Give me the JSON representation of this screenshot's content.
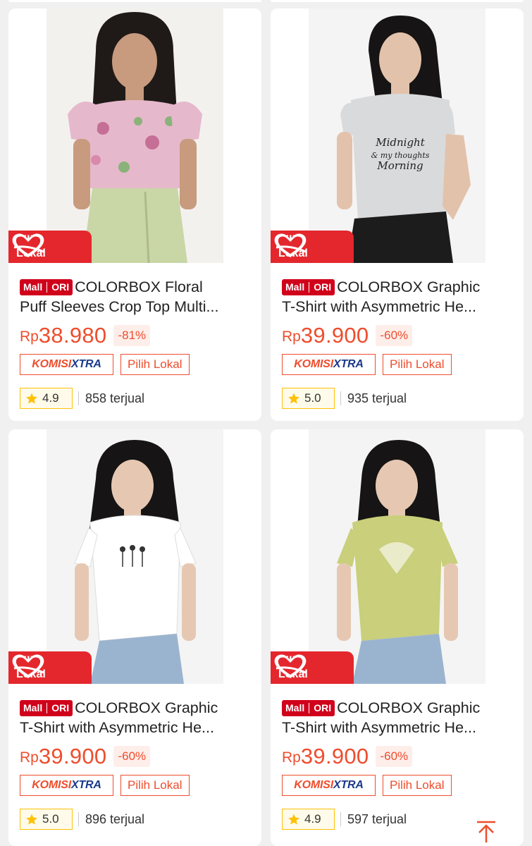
{
  "products": [
    {
      "mall_label": "Mall",
      "ori_label": "ORI",
      "title_line1": "COLORBOX Floral",
      "title_line2": "Puff Sleeves Crop Top Multi...",
      "currency": "Rp",
      "price": "38.980",
      "discount": "-81%",
      "komisi_a": "KOMISI",
      "komisi_b": "XTRA",
      "tag": "Pilih Lokal",
      "rating": "4.9",
      "sold": "858 terjual",
      "badge_line1": "Pilih",
      "badge_line2": "Lokal",
      "palette": {
        "bg": "#f3f1ee",
        "top": "#e6b8cc",
        "bottom": "#c9d6a6",
        "hair": "#1f1a18",
        "skin": "#c89a7e"
      }
    },
    {
      "mall_label": "Mall",
      "ori_label": "ORI",
      "title_line1": "COLORBOX Graphic",
      "title_line2": "T-Shirt with Asymmetric He...",
      "currency": "Rp",
      "price": "39.900",
      "discount": "-60%",
      "komisi_a": "KOMISI",
      "komisi_b": "XTRA",
      "tag": "Pilih Lokal",
      "rating": "5.0",
      "sold": "935 terjual",
      "badge_line1": "Pilih",
      "badge_line2": "Lokal",
      "palette": {
        "bg": "#f4f4f4",
        "top": "#d9dadc",
        "bottom": "#1c1c1c",
        "hair": "#161414",
        "skin": "#e3c2ab"
      }
    },
    {
      "mall_label": "Mall",
      "ori_label": "ORI",
      "title_line1": "COLORBOX Graphic",
      "title_line2": "T-Shirt with Asymmetric He...",
      "currency": "Rp",
      "price": "39.900",
      "discount": "-60%",
      "komisi_a": "KOMISI",
      "komisi_b": "XTRA",
      "tag": "Pilih Lokal",
      "rating": "5.0",
      "sold": "896 terjual",
      "badge_line1": "Pilih",
      "badge_line2": "Lokal",
      "palette": {
        "bg": "#f4f4f4",
        "top": "#ffffff",
        "bottom": "#9ab4d0",
        "hair": "#161414",
        "skin": "#e6c8b2"
      }
    },
    {
      "mall_label": "Mall",
      "ori_label": "ORI",
      "title_line1": "COLORBOX Graphic",
      "title_line2": "T-Shirt with Asymmetric He...",
      "currency": "Rp",
      "price": "39.900",
      "discount": "-60%",
      "komisi_a": "KOMISI",
      "komisi_b": "XTRA",
      "tag": "Pilih Lokal",
      "rating": "4.9",
      "sold": "597 terjual",
      "badge_line1": "Pilih",
      "badge_line2": "Lokal",
      "palette": {
        "bg": "#f4f4f4",
        "top": "#c9cf7a",
        "bottom": "#9ab4d0",
        "hair": "#161414",
        "skin": "#e6c8b2"
      }
    }
  ],
  "scroll_top_icon": "arrow-up-to-line-icon",
  "colors": {
    "accent": "#ee4d2d",
    "mall_red": "#d0011b",
    "badge_red": "#e4272d",
    "star": "#ffc107"
  }
}
